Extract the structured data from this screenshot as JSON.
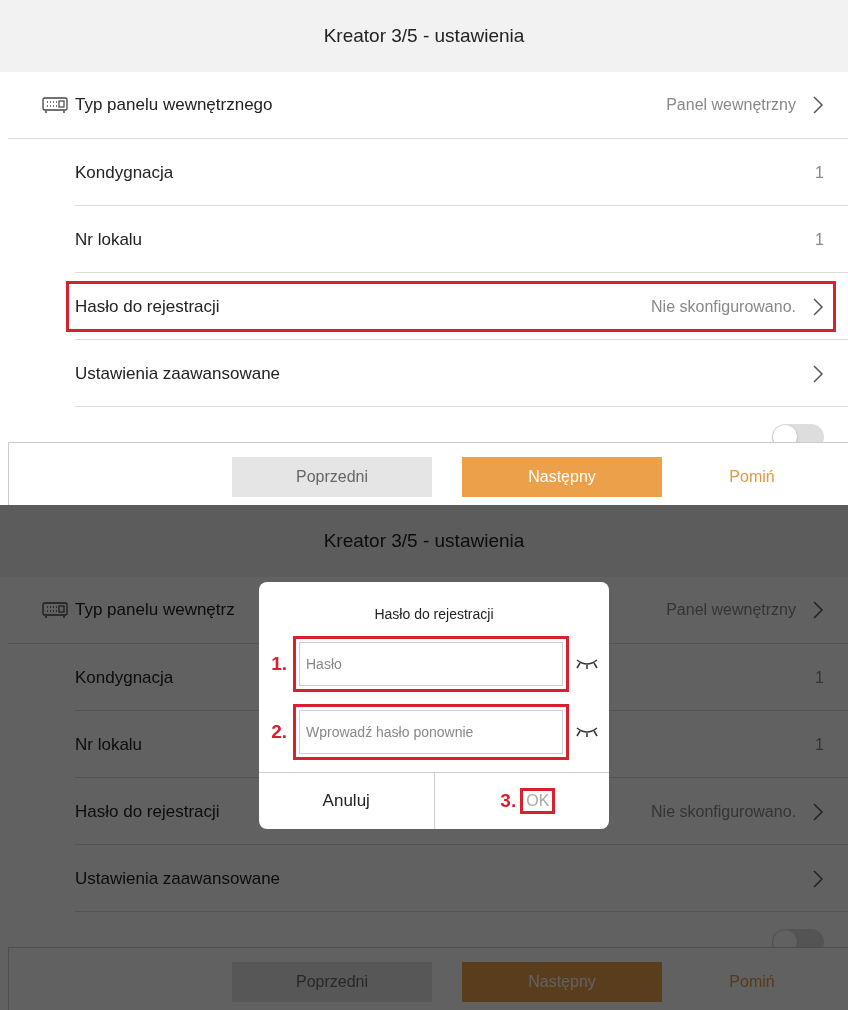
{
  "screens": [
    {
      "title": "Kreator 3/5 - ustawienia",
      "rows": [
        {
          "kind": "device",
          "label": "Typ panelu wewnętrznego",
          "value": "Panel wewnętrzny",
          "highlighted": false
        },
        {
          "kind": "value",
          "label": "Kondygnacja",
          "value": "1",
          "highlighted": false
        },
        {
          "kind": "value",
          "label": "Nr lokalu",
          "value": "1",
          "highlighted": false
        },
        {
          "kind": "select",
          "label": "Hasło do rejestracji",
          "value": "Nie skonfigurowano.",
          "highlighted": true
        },
        {
          "kind": "link",
          "label": "Ustawienia zaawansowane",
          "highlighted": false
        },
        {
          "kind": "toggle",
          "on": false,
          "highlighted": false
        }
      ],
      "buttons": [
        {
          "kind": "secondary",
          "label": "Poprzedni"
        },
        {
          "kind": "primary",
          "label": "Następny"
        },
        {
          "kind": "text",
          "label": "Pomiń"
        }
      ]
    },
    {
      "title": "Kreator 3/5 - ustawienia",
      "rows": [
        {
          "kind": "device",
          "label": "Typ panelu wewnętrz",
          "value": "Panel wewnętrzny",
          "highlighted": false
        },
        {
          "kind": "value",
          "label": "Kondygnacja",
          "value": "1",
          "highlighted": false
        },
        {
          "kind": "value",
          "label": "Nr lokalu",
          "value": "1",
          "highlighted": false
        },
        {
          "kind": "select",
          "label": "Hasło do rejestracji",
          "value": "Nie skonfigurowano.",
          "highlighted": false
        },
        {
          "kind": "link",
          "label": "Ustawienia zaawansowane",
          "highlighted": false
        },
        {
          "kind": "toggle",
          "on": false,
          "highlighted": false
        }
      ],
      "buttons": [
        {
          "kind": "secondary",
          "label": "Poprzedni"
        },
        {
          "kind": "primary",
          "label": "Następny"
        },
        {
          "kind": "text",
          "label": "Pomiń"
        }
      ],
      "dialog": {
        "title": "Hasło do rejestracji",
        "fields": [
          {
            "placeholder": "Hasło",
            "marker": "1."
          },
          {
            "placeholder": "Wprowadź hasło ponownie",
            "marker": "2."
          }
        ],
        "cancel": {
          "label": "Anuluj"
        },
        "ok": {
          "label": "OK",
          "disabled": true,
          "marker": "3."
        }
      }
    }
  ]
}
